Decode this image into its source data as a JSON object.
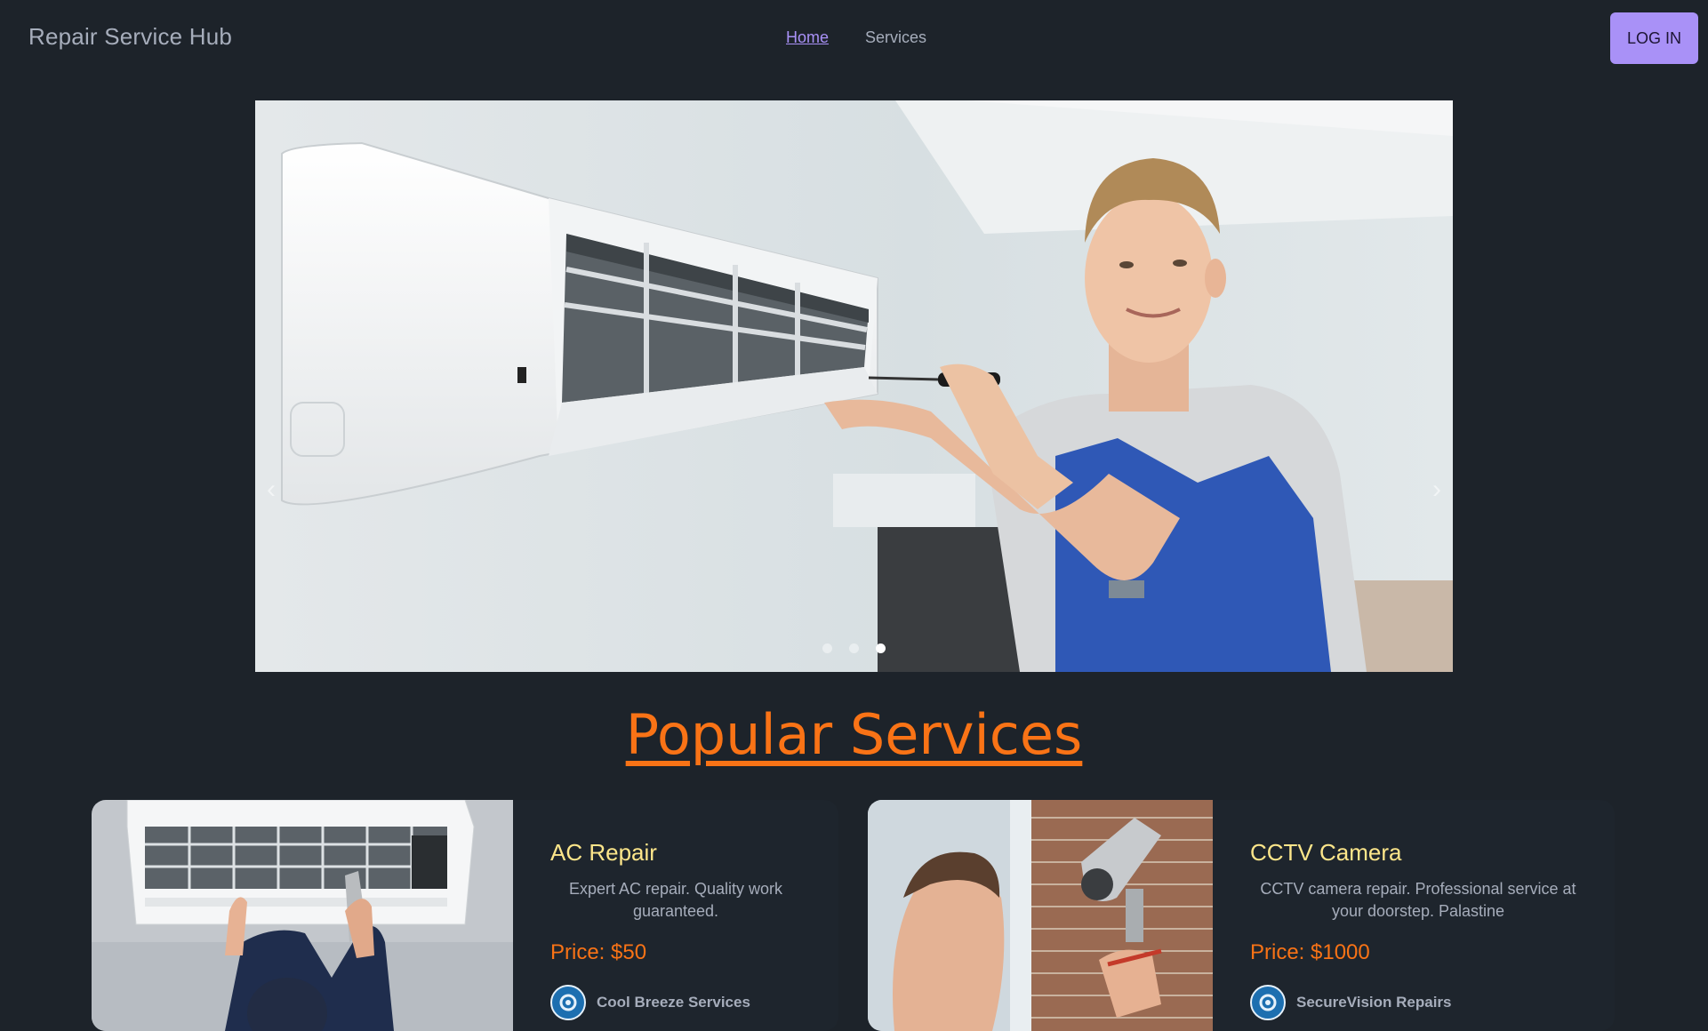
{
  "navbar": {
    "brand": "Repair Service Hub",
    "links": [
      {
        "label": "Home",
        "active": true
      },
      {
        "label": "Services",
        "active": false
      }
    ],
    "login_label": "LOG IN"
  },
  "carousel": {
    "slide_count": 3,
    "active_slide": 3,
    "prev_icon": "chevron-left-icon",
    "next_icon": "chevron-right-icon"
  },
  "section": {
    "title": "Popular Services"
  },
  "services": [
    {
      "title": "AC Repair",
      "description": "Expert AC repair. Quality work guaranteed.",
      "price": "Price: $50",
      "provider": "Cool Breeze Services"
    },
    {
      "title": "CCTV Camera",
      "description": "CCTV camera repair. Professional service at your doorstep. Palastine",
      "price": "Price: $1000",
      "provider": "SecureVision Repairs"
    }
  ],
  "colors": {
    "background": "#1d232a",
    "accent": "#a991f7",
    "title_orange": "#f97316",
    "card_title": "#fde68a"
  }
}
